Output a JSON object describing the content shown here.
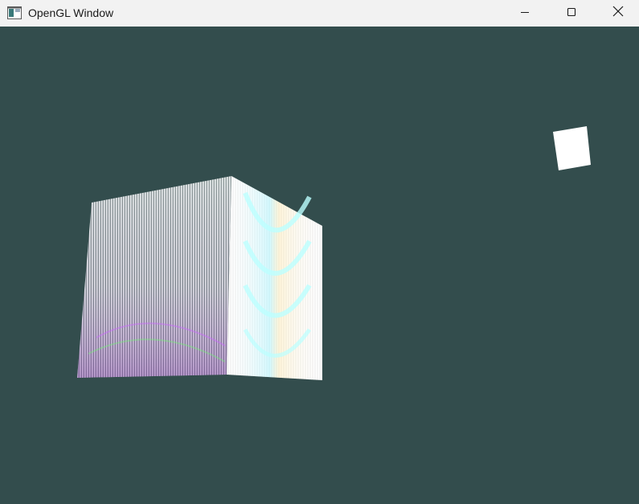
{
  "window": {
    "title": "OpenGL Window",
    "app_icon": "window-app-icon",
    "controls": {
      "minimize_icon": "minimize-icon",
      "maximize_icon": "maximize-icon",
      "close_icon": "close-icon"
    }
  },
  "viewport": {
    "clear_color": "#334d4d",
    "objects": [
      {
        "name": "textured-cube",
        "description_color": "#ffffff"
      },
      {
        "name": "light-source-cube",
        "color": "#ffffff"
      }
    ]
  }
}
